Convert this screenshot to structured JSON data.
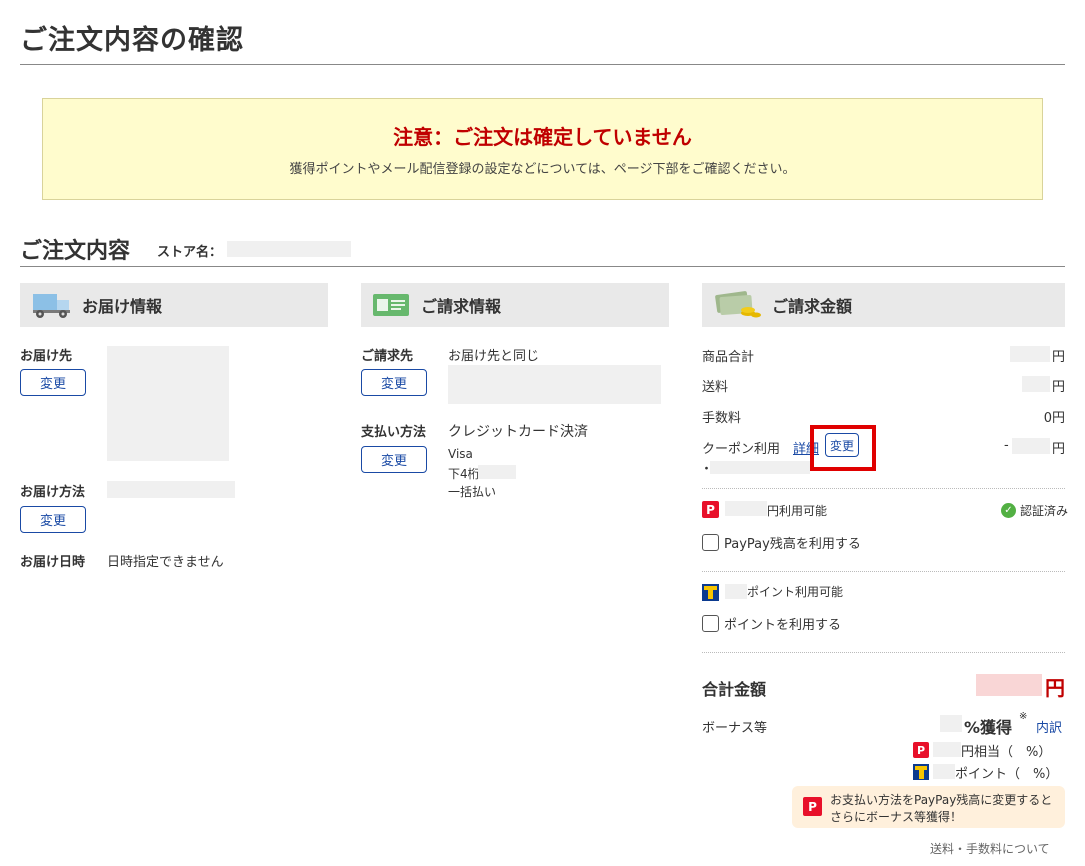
{
  "page": {
    "title": "ご注文内容の確認"
  },
  "notice": {
    "title": "注意：ご注文は確定していません",
    "text": "獲得ポイントやメール配信登録の設定などについては、ページ下部をご確認ください。"
  },
  "order": {
    "section_title": "ご注文内容",
    "store_label": "ストア名："
  },
  "delivery": {
    "header": "お届け情報",
    "dest_label": "お届け先",
    "change_label": "変更",
    "method_label": "お届け方法",
    "date_label": "お届け日時",
    "date_value": "日時指定できません"
  },
  "billing": {
    "header": "ご請求情報",
    "addr_label": "ご請求先",
    "addr_value": "お届け先と同じ",
    "change_label": "変更",
    "pay_label": "支払い方法",
    "pay_value": "クレジットカード決済",
    "card_brand": "Visa",
    "card_last4_label": "下4桁",
    "installment": "一括払い"
  },
  "amount": {
    "header": "ご請求金額",
    "subtotal_label": "商品合計",
    "subtotal_unit": "円",
    "shipping_label": "送料",
    "shipping_unit": "円",
    "fee_label": "手数料",
    "fee_value": "0円",
    "coupon_label": "クーポン利用",
    "coupon_detail": "詳細",
    "coupon_change": "変更",
    "coupon_minus": "-",
    "coupon_unit": "円",
    "bullet": "・",
    "paypay_available": "円利用可能",
    "verified": "認証済み",
    "paypay_checkbox": "PayPay残高を利用する",
    "points_available": "ポイント利用可能",
    "points_checkbox": "ポイントを利用する",
    "total_label": "合計金額",
    "total_unit": "円",
    "bonus_label": "ボーナス等",
    "bonus_value": "%獲得",
    "bonus_note": "※",
    "breakdown_link": "内訳",
    "paypay_bonus": "円相当（　%）",
    "point_bonus": "ポイント（　%）",
    "promo_line1": "お支払い方法をPayPay残高に変更すると",
    "promo_line2": "さらにボーナス等獲得！",
    "footer_link": "送料・手数料について"
  },
  "colors": {
    "accent": "#1a4aa5",
    "warning": "#c00000",
    "paypay": "#e8102a",
    "tpoint": "#0b3a8f"
  },
  "icons": [
    "truck-icon",
    "card-icon",
    "money-icon",
    "paypay-icon",
    "tpoint-icon",
    "check-icon"
  ]
}
